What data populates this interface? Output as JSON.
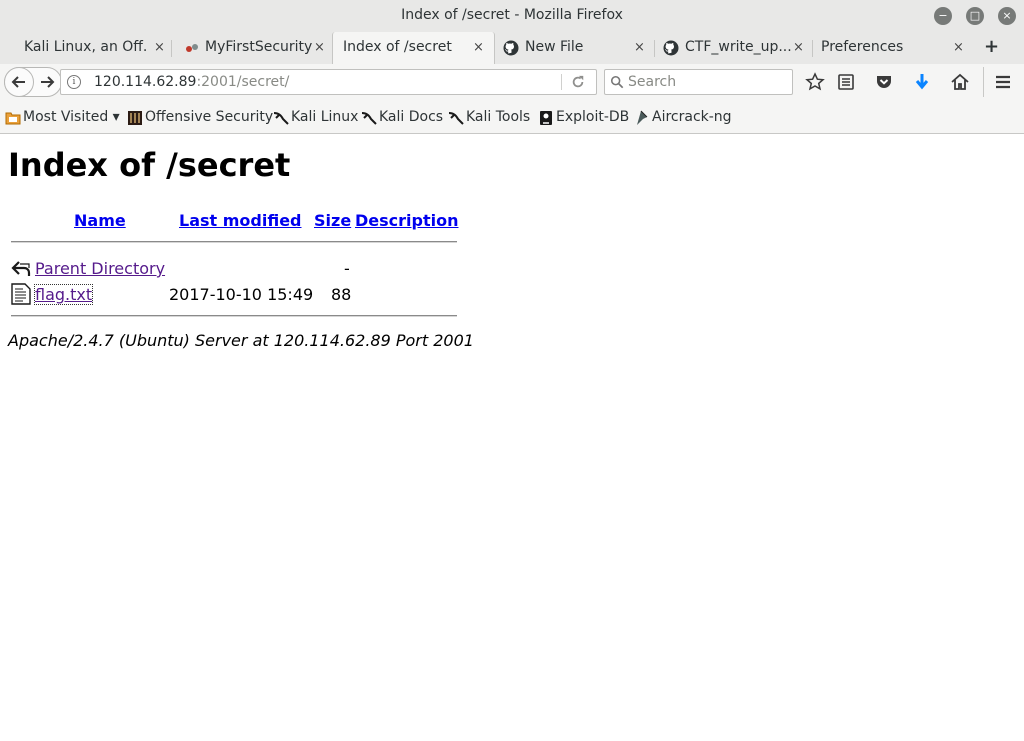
{
  "window": {
    "title": "Index of /secret - Mozilla Firefox",
    "controls": {
      "minimize": "−",
      "maximize": "□",
      "close": "×"
    }
  },
  "tabs": [
    {
      "label": "Kali Linux, an Off...",
      "icon": "none",
      "active": false
    },
    {
      "label": "MyFirstSecurity",
      "icon": "mfs-favicon",
      "active": false
    },
    {
      "label": "Index of /secret",
      "icon": "none",
      "active": true
    },
    {
      "label": "New File",
      "icon": "github-icon",
      "active": false
    },
    {
      "label": "CTF_write_up...",
      "icon": "github-icon",
      "active": false
    },
    {
      "label": "Preferences",
      "icon": "none",
      "active": false
    }
  ],
  "tab_close": "×",
  "new_tab": "+",
  "urlbar": {
    "host": "120.114.62.89",
    "rest": ":2001/secret/"
  },
  "search": {
    "placeholder": "Search"
  },
  "bookmarks": [
    {
      "label": "Most Visited ▾",
      "icon": "folder-icon"
    },
    {
      "label": "Offensive Security",
      "icon": "offsec-icon"
    },
    {
      "label": "Kali Linux",
      "icon": "kali-dragon-icon"
    },
    {
      "label": "Kali Docs",
      "icon": "kali-dragon-icon"
    },
    {
      "label": "Kali Tools",
      "icon": "kali-dragon-icon"
    },
    {
      "label": "Exploit-DB",
      "icon": "exploitdb-icon"
    },
    {
      "label": "Aircrack-ng",
      "icon": "aircrack-icon"
    }
  ],
  "page": {
    "heading": "Index of /secret",
    "columns": {
      "name": "Name",
      "modified": "Last modified",
      "size": "Size",
      "description": "Description"
    },
    "rows": [
      {
        "name": "Parent Directory",
        "modified": "",
        "size": "-",
        "description": "",
        "icon": "back-folder-icon"
      },
      {
        "name": "flag.txt",
        "modified": "2017-10-10 15:49",
        "size": "88",
        "description": "",
        "icon": "text-file-icon"
      }
    ],
    "footer": "Apache/2.4.7 (Ubuntu) Server at 120.114.62.89 Port 2001"
  },
  "colors": {
    "link": "#0000ee",
    "visited_link": "#551a8b",
    "chrome_bg": "#e8e8e7",
    "download_arrow": "#0a84ff"
  }
}
